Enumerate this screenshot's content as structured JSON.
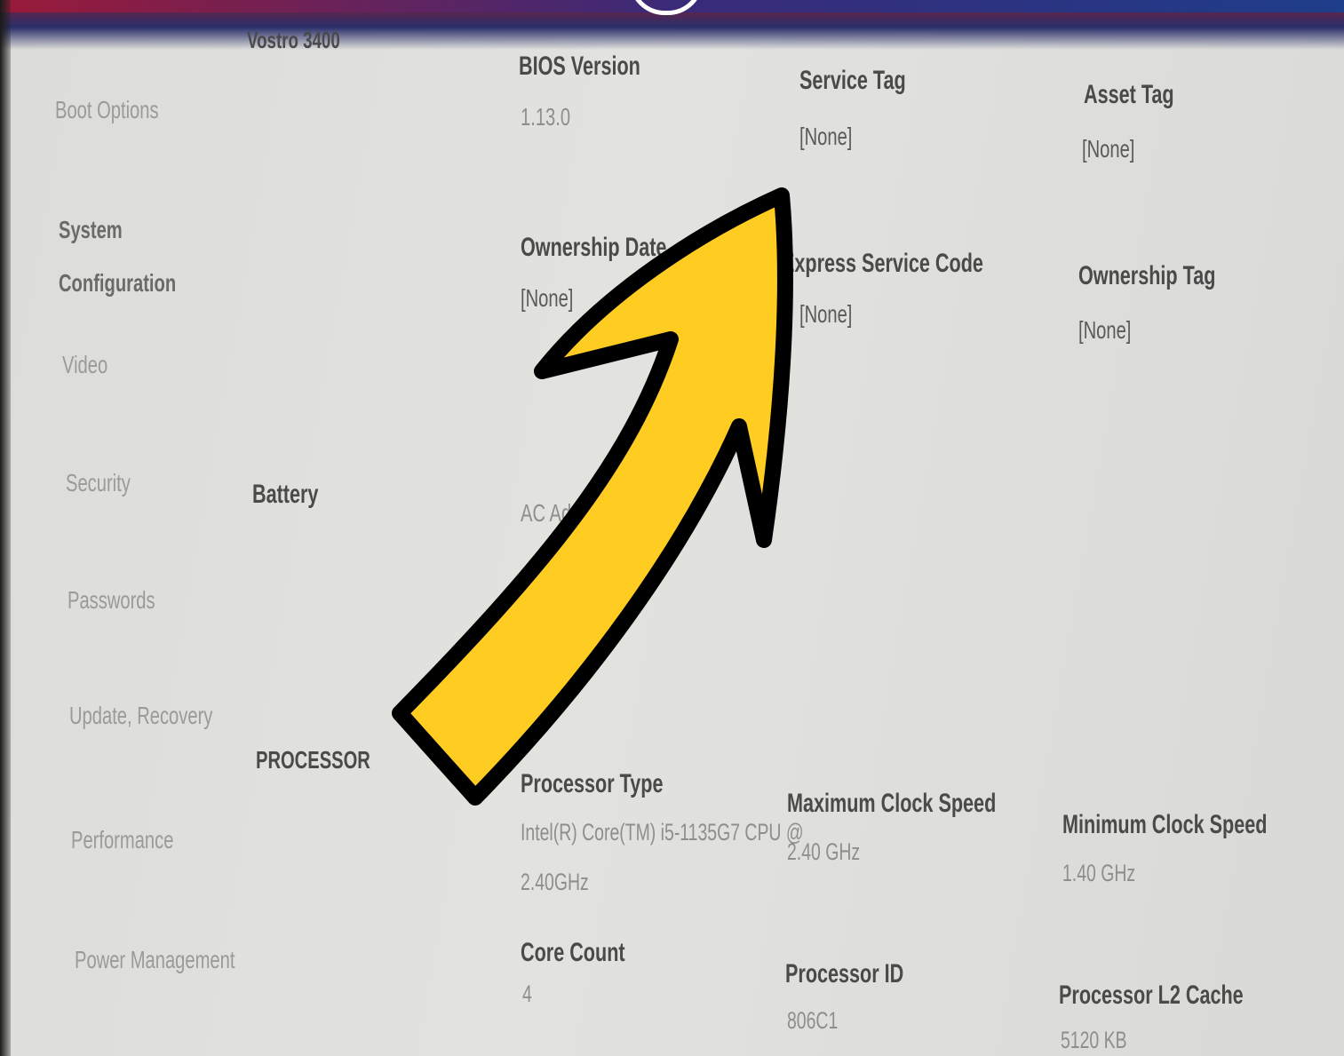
{
  "sidebar": {
    "items": [
      {
        "label": "Boot Options"
      },
      {
        "label": "System"
      },
      {
        "label": "Configuration"
      },
      {
        "label": "Video"
      },
      {
        "label": "Security"
      },
      {
        "label": "Passwords"
      },
      {
        "label": "Update, Recovery"
      },
      {
        "label": "Performance"
      },
      {
        "label": "Power Management"
      }
    ]
  },
  "overview": {
    "model": "Vostro 3400",
    "bios_version_label": "BIOS Version",
    "bios_version_value": "1.13.0",
    "service_tag_label": "Service Tag",
    "service_tag_value": "[None]",
    "asset_tag_label": "Asset Tag",
    "asset_tag_value": "[None]",
    "ownership_date_label": "Ownership Date",
    "ownership_date_value": "[None]",
    "express_service_code_label": "Express Service Code",
    "express_service_code_value": "[None]",
    "ownership_tag_label": "Ownership Tag",
    "ownership_tag_value": "[None]"
  },
  "battery": {
    "section_label": "Battery",
    "ac_adapter_label": "AC Adapter"
  },
  "processor": {
    "section_label": "PROCESSOR",
    "type_label": "Processor Type",
    "type_value_line1": "Intel(R) Core(TM) i5-1135G7 CPU @",
    "type_value_line2": "2.40GHz",
    "max_clock_label": "Maximum Clock Speed",
    "max_clock_value": "2.40 GHz",
    "min_clock_label": "Minimum Clock Speed",
    "min_clock_value": "1.40 GHz",
    "core_count_label": "Core Count",
    "core_count_value": "4",
    "processor_id_label": "Processor ID",
    "processor_id_value": "806C1",
    "l2_cache_label": "Processor L2 Cache",
    "l2_cache_value": "5120 KB"
  },
  "overlay": {
    "arrow_icon": "curved-arrow-icon",
    "arrow_fill": "#FFCC22",
    "arrow_stroke": "#000000"
  }
}
